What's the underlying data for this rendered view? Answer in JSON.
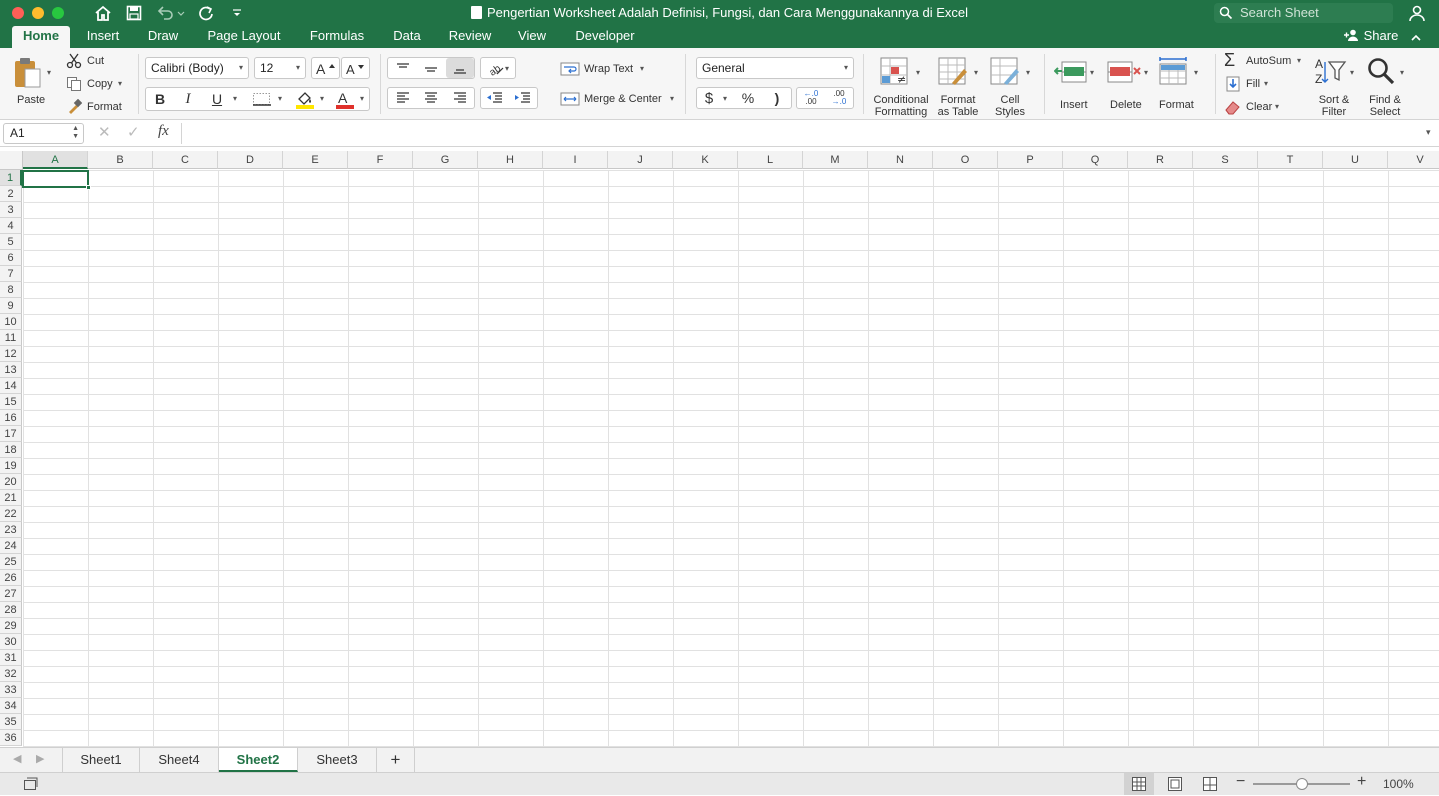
{
  "window": {
    "title": "Pengertian Worksheet Adalah Definisi, Fungsi, dan Cara Menggunakannya di Excel",
    "search_placeholder": "Search Sheet",
    "share_label": "Share"
  },
  "ribbon_tabs": [
    "Home",
    "Insert",
    "Draw",
    "Page Layout",
    "Formulas",
    "Data",
    "Review",
    "View",
    "Developer"
  ],
  "active_tab": "Home",
  "clipboard": {
    "paste": "Paste",
    "cut": "Cut",
    "copy": "Copy",
    "format": "Format"
  },
  "font": {
    "name": "Calibri (Body)",
    "size": "12",
    "bold": "B",
    "italic": "I",
    "underline": "U"
  },
  "alignment": {
    "wrap_text": "Wrap Text",
    "merge_center": "Merge & Center"
  },
  "number": {
    "format": "General",
    "currency": "$",
    "percent": "%",
    "comma": ")",
    "inc_decimal": ".00",
    "dec_decimal": ".0"
  },
  "styles": {
    "conditional_1": "Conditional",
    "conditional_2": "Formatting",
    "table_1": "Format",
    "table_2": "as Table",
    "cell_1": "Cell",
    "cell_2": "Styles"
  },
  "cells": {
    "insert": "Insert",
    "delete": "Delete",
    "format": "Format"
  },
  "editing": {
    "autosum": "AutoSum",
    "fill": "Fill",
    "clear": "Clear",
    "sort_1": "Sort &",
    "sort_2": "Filter",
    "find_1": "Find &",
    "find_2": "Select"
  },
  "formula_bar": {
    "name_box": "A1",
    "fx": "fx",
    "value": ""
  },
  "columns": [
    "A",
    "B",
    "C",
    "D",
    "E",
    "F",
    "G",
    "H",
    "I",
    "J",
    "K",
    "L",
    "M",
    "N",
    "O",
    "P",
    "Q",
    "R",
    "S",
    "T",
    "U",
    "V"
  ],
  "rows": [
    "1",
    "2",
    "3",
    "4",
    "5",
    "6",
    "7",
    "8",
    "9",
    "10",
    "11",
    "12",
    "13",
    "14",
    "15",
    "16",
    "17",
    "18",
    "19",
    "20",
    "21",
    "22",
    "23",
    "24",
    "25",
    "26",
    "27",
    "28",
    "29",
    "30",
    "31",
    "32",
    "33",
    "34",
    "35",
    "36"
  ],
  "selected_cell": "A1",
  "sheets": [
    "Sheet1",
    "Sheet4",
    "Sheet2",
    "Sheet3"
  ],
  "active_sheet": "Sheet2",
  "add_sheet": "+",
  "zoom": "100%",
  "colors": {
    "accent": "#217346",
    "gridline": "#e1e1e1"
  }
}
